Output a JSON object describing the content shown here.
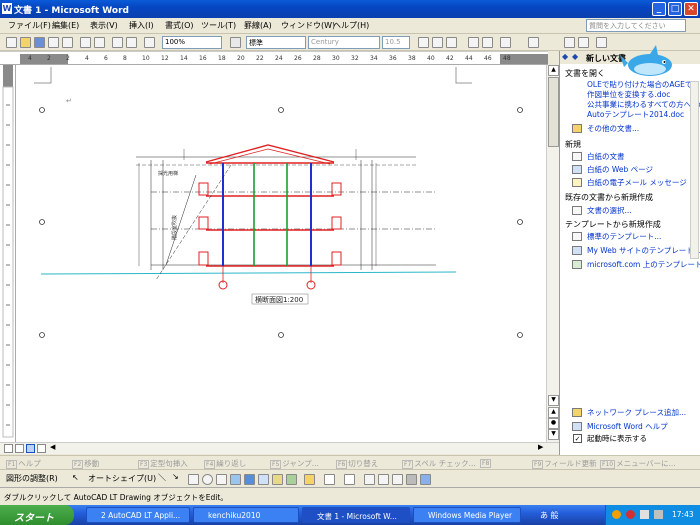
{
  "window": {
    "title": "文書 1 - Microsoft Word"
  },
  "menu": {
    "items": [
      "ファイル(F)",
      "編集(E)",
      "表示(V)",
      "挿入(I)",
      "書式(O)",
      "ツール(T)",
      "罫線(A)",
      "ウィンドウ(W)",
      "ヘルプ(H)"
    ],
    "ask_placeholder": "質問を入力してください"
  },
  "toolbar": {
    "zoom": "100%",
    "style": "標準",
    "font": "Century",
    "size": "10.5"
  },
  "ruler": {
    "ticks": [
      "4",
      "2",
      "2",
      "4",
      "6",
      "8",
      "10",
      "12",
      "14",
      "16",
      "18",
      "20",
      "22",
      "24",
      "26",
      "28",
      "30",
      "32",
      "34",
      "36",
      "38",
      "40",
      "42",
      "44",
      "46",
      "48"
    ]
  },
  "drawing": {
    "caption": "横断面図1:200",
    "note1": "採光用梯",
    "note2": "階段室吹抜"
  },
  "taskpane": {
    "title": "新しい文書",
    "open_section": "文書を開く",
    "recent_files": [
      "OLEで貼り付けた場合のAGEで...",
      "作図単位を変換する.doc",
      "公共事業に携わるすべての方へ.doc",
      "Autoテンプレート2014.doc"
    ],
    "more_docs": "その他の文書...",
    "new_section": "新規",
    "new_items": [
      "白紙の文書",
      "白紙の Web ページ",
      "白紙の電子メール メッセージ"
    ],
    "existing_section": "既存の文書から新規作成",
    "existing_item": "文書の選択...",
    "template_section": "テンプレートから新規作成",
    "template_items": [
      "標準のテンプレート...",
      "My Web サイトのテンプレート...",
      "microsoft.com 上のテンプレート"
    ],
    "network_place": "ネットワーク プレース追加...",
    "word_help": "Microsoft Word ヘルプ",
    "show_on_startup": "起動時に表示する"
  },
  "fkeys": [
    {
      "key": "F1",
      "label": "ヘルプ"
    },
    {
      "key": "F2",
      "label": "移動"
    },
    {
      "key": "F3",
      "label": "定型句挿入"
    },
    {
      "key": "F4",
      "label": "繰り返し"
    },
    {
      "key": "F5",
      "label": "ジャンプ..."
    },
    {
      "key": "F6",
      "label": "切り替え"
    },
    {
      "key": "F7",
      "label": "スペル チェック..."
    },
    {
      "key": "F8",
      "label": ""
    },
    {
      "key": "F9",
      "label": "フィールド更新"
    },
    {
      "key": "F10",
      "label": "メニューバーに..."
    }
  ],
  "drawbar": {
    "adjust": "図形の調整(R)",
    "autoshape": "オートシェイプ(U)"
  },
  "status": {
    "hint": "ダブルクリックして AutoCAD LT Drawing オブジェクトをEdit。"
  },
  "taskbar": {
    "start": "スタート",
    "tasks": [
      "2 AutoCAD LT Appli...",
      "kenchiku2010",
      "文書 1 - Microsoft W...",
      "Windows Media Player"
    ],
    "clock": "17:43",
    "ime": "あ 般"
  },
  "colors": {
    "title_blue": "#0a5bd8",
    "link_blue": "#0033cc",
    "start_green": "#2f8e2f",
    "drawing_red": "#e02020"
  }
}
